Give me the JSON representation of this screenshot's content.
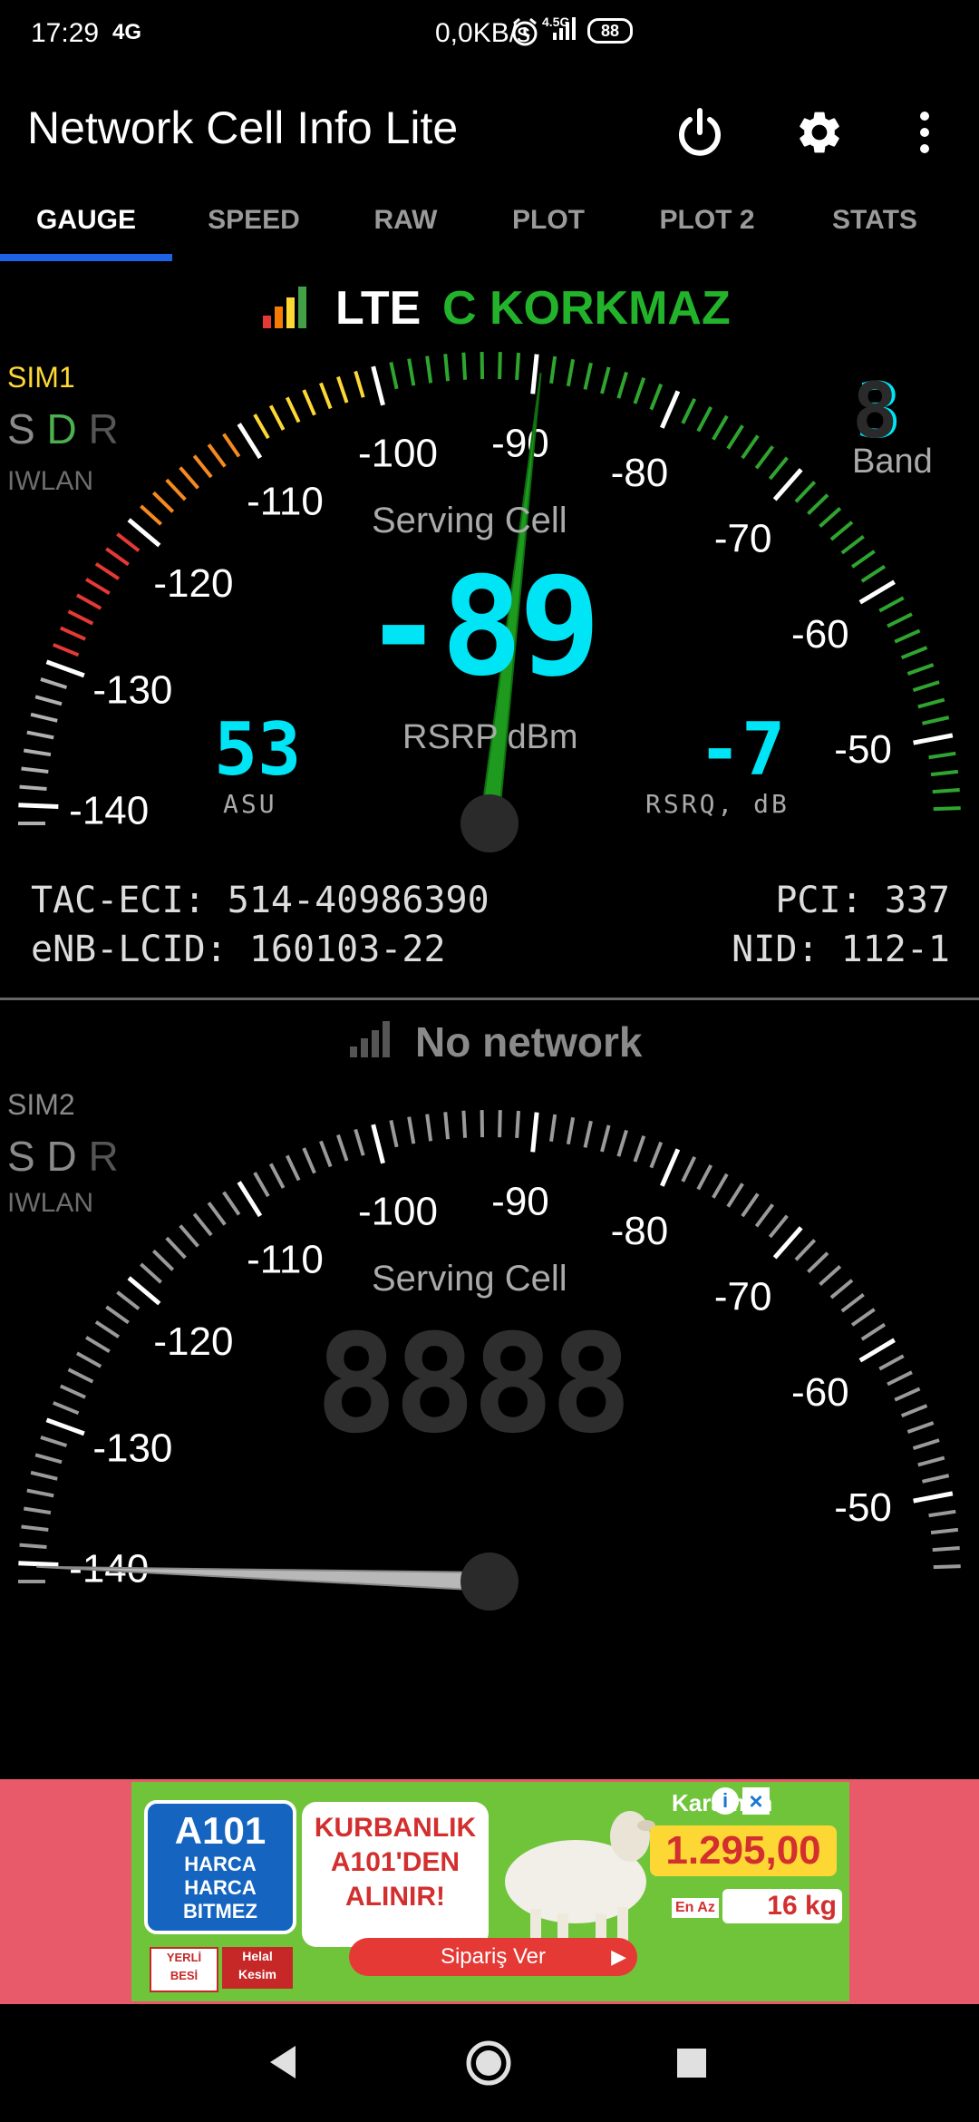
{
  "status_bar": {
    "time": "17:29",
    "network_type": "4G",
    "speed": "0,0KB/s",
    "network_gen": "4.5G",
    "battery": "88",
    "icons": [
      "alarm-icon",
      "signal-icon",
      "battery-icon"
    ]
  },
  "app_bar": {
    "title": "Network Cell Info Lite",
    "icons": [
      "power-icon",
      "settings-gear-icon",
      "more-vert-icon"
    ]
  },
  "tabs": [
    {
      "label": "GAUGE",
      "active": true
    },
    {
      "label": "SPEED"
    },
    {
      "label": "RAW"
    },
    {
      "label": "PLOT"
    },
    {
      "label": "PLOT 2"
    },
    {
      "label": "STATS"
    }
  ],
  "sim1": {
    "tech": "LTE",
    "operator": "C KORKMAZ",
    "sim_label": "SIM1",
    "sdr": [
      "S",
      "D",
      "R"
    ],
    "iwlan": "IWLAN",
    "band_value": "3",
    "band_label": "Band",
    "serving_label": "Serving Cell",
    "rsrp_value": "-89",
    "rsrp_label": "RSRP dBm",
    "asu_value": "53",
    "asu_label": "ASU",
    "rsrq_value": "-7",
    "rsrq_label": "RSRQ, dB",
    "tac_eci": "TAC-ECI: 514-40986390",
    "enb_lcid": "eNB-LCID: 160103-22",
    "pci": "PCI: 337",
    "nid": "NID: 112-1",
    "gauge_level_dbm": -89,
    "scale_labels": [
      "-140",
      "-130",
      "-120",
      "-110",
      "-100",
      "-90",
      "-80",
      "-70",
      "-60",
      "-50"
    ]
  },
  "sim2": {
    "status": "No network",
    "sim_label": "SIM2",
    "sdr": [
      "S",
      "D",
      "R"
    ],
    "iwlan": "IWLAN",
    "serving_label": "Serving Cell",
    "gauge_level_dbm": -140,
    "scale_labels": [
      "-140",
      "-130",
      "-120",
      "-110",
      "-100",
      "-90",
      "-80",
      "-70",
      "-60",
      "-50"
    ]
  },
  "ad": {
    "brand": "A101",
    "slogan": "HARCA HARCA BITMEZ",
    "headline": "KURBANLIK A101'DEN ALINIR!",
    "location": "Karaman",
    "price": "1.295,00",
    "weight": "16 kg",
    "weight_prefix": "En Az",
    "cta": "Sipariş Ver",
    "badges": [
      "YERLİ BESİ",
      "Helal Kesim"
    ]
  },
  "nav_bar": {
    "icons": [
      "back-icon",
      "home-icon",
      "recents-icon"
    ]
  }
}
